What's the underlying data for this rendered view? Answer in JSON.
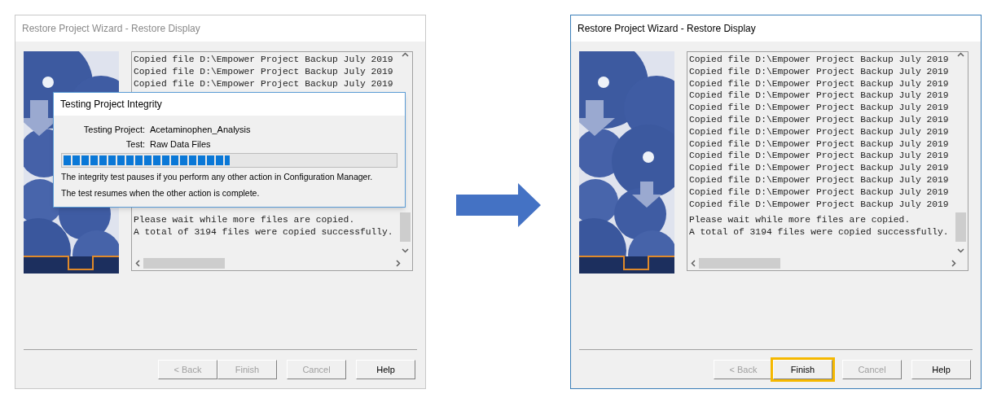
{
  "panels": [
    {
      "window": {
        "title": "Restore Project Wizard - Restore Display",
        "active": false
      },
      "log": {
        "copied": [
          "Copied file D:\\Empower Project Backup July 2019",
          "Copied file D:\\Empower Project Backup July 2019",
          "Copied file D:\\Empower Project Backup July 2019"
        ],
        "summary": [
          "Please wait while more files are copied.",
          "A total of 3194 files were copied successfully."
        ]
      },
      "dialog": {
        "title": "Testing Project Integrity",
        "fields": [
          {
            "label": "Testing Project:",
            "value": "Acetaminophen_Analysis"
          },
          {
            "label": "Test:",
            "value": "Raw Data Files"
          }
        ],
        "progress": {
          "level": 0.5
        },
        "message": [
          "The integrity test pauses if you perform any other action in Configuration Manager.",
          "The test resumes when the other action is complete."
        ]
      },
      "buttons": [
        {
          "label": "< Back",
          "disabled": true,
          "highlighted": false
        },
        {
          "label": "Finish",
          "disabled": true,
          "highlighted": false
        },
        {
          "label": "Cancel",
          "disabled": true,
          "highlighted": false
        },
        {
          "label": "Help",
          "disabled": false,
          "highlighted": false
        }
      ]
    },
    {
      "window": {
        "title": "Restore Project Wizard - Restore Display",
        "active": true
      },
      "log": {
        "copied": [
          "Copied file D:\\Empower Project Backup July 2019",
          "Copied file D:\\Empower Project Backup July 2019",
          "Copied file D:\\Empower Project Backup July 2019",
          "Copied file D:\\Empower Project Backup July 2019",
          "Copied file D:\\Empower Project Backup July 2019",
          "Copied file D:\\Empower Project Backup July 2019",
          "Copied file D:\\Empower Project Backup July 2019",
          "Copied file D:\\Empower Project Backup July 2019",
          "Copied file D:\\Empower Project Backup July 2019",
          "Copied file D:\\Empower Project Backup July 2019",
          "Copied file D:\\Empower Project Backup July 2019",
          "Copied file D:\\Empower Project Backup July 2019",
          "Copied file D:\\Empower Project Backup July 2019"
        ],
        "summary": [
          "Please wait while more files are copied.",
          "A total of 3194 files were copied successfully."
        ]
      },
      "buttons": [
        {
          "label": "< Back",
          "disabled": true,
          "highlighted": false
        },
        {
          "label": "Finish",
          "disabled": false,
          "highlighted": true
        },
        {
          "label": "Cancel",
          "disabled": true,
          "highlighted": false
        },
        {
          "label": "Help",
          "disabled": false,
          "highlighted": false
        }
      ]
    }
  ]
}
